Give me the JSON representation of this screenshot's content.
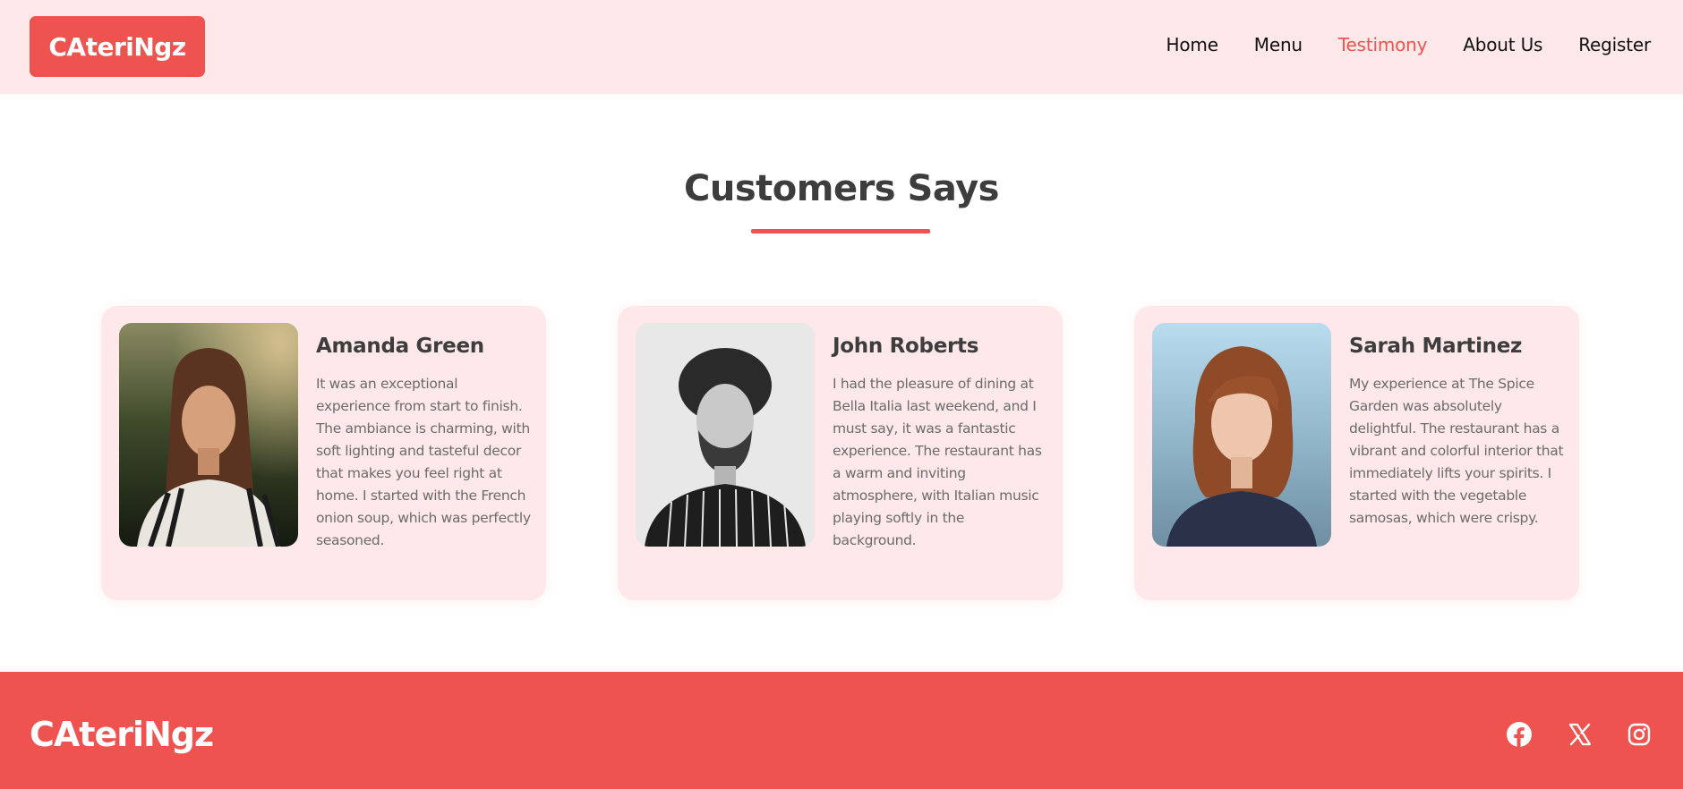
{
  "header": {
    "logo": "CAteriNgz",
    "nav": [
      {
        "label": "Home",
        "active": false
      },
      {
        "label": "Menu",
        "active": false
      },
      {
        "label": "Testimony",
        "active": true
      },
      {
        "label": "About Us",
        "active": false
      },
      {
        "label": "Register",
        "active": false
      }
    ]
  },
  "section": {
    "title": "Customers Says"
  },
  "testimonials": [
    {
      "name": "Amanda Green",
      "text": "It was an exceptional experience from start to finish. The ambiance is charming, with soft lighting and tasteful decor that makes you feel right at home. I started with the French onion soup, which was perfectly seasoned."
    },
    {
      "name": "John Roberts",
      "text": "I had the pleasure of dining at Bella Italia last weekend, and I must say, it was a fantastic experience. The restaurant has a warm and inviting atmosphere, with Italian music playing softly in the background."
    },
    {
      "name": "Sarah Martinez",
      "text": "My experience at The Spice Garden was absolutely delightful. The restaurant has a vibrant and colorful interior that immediately lifts your spirits. I started with the vegetable samosas, which were crispy."
    }
  ],
  "footer": {
    "logo": "CAteriNgz",
    "social": [
      "facebook-icon",
      "x-twitter-icon",
      "instagram-icon"
    ]
  },
  "colors": {
    "accent": "#ef5350",
    "header_bg": "#ffe8ea",
    "card_bg": "#ffe8ea",
    "heading": "#3d3d3d",
    "body_text": "#6b6b6b"
  }
}
